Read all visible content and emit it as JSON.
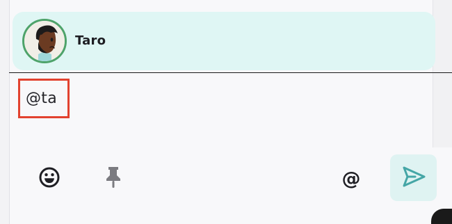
{
  "mention_suggestions": [
    {
      "name": "Taro",
      "avatar": "taro-avatar"
    }
  ],
  "composer": {
    "text": "@ta"
  },
  "toolbar": {
    "emoji_icon": "smiley-face-icon",
    "pin_icon": "pin-icon",
    "mention_symbol": "@",
    "send_icon": "send-icon"
  },
  "colors": {
    "suggestion_background": "#dff6f4",
    "avatar_ring": "#4ea36a",
    "highlight_box": "#e2422f",
    "send_button_background": "#dff3f2",
    "send_icon": "#45a6a6"
  }
}
